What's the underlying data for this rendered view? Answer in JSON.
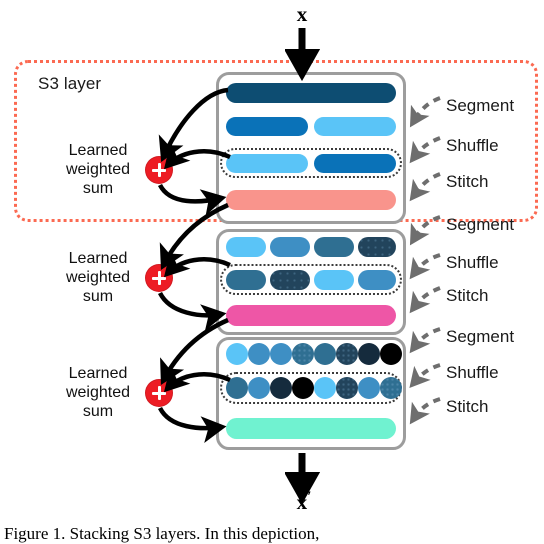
{
  "figure": {
    "input_label": "x",
    "output_label": "x",
    "output_prime": "′",
    "region_label": "S3 layer",
    "caption": "Figure 1.  Stacking S3 layers.  In this depiction,"
  },
  "colors": {
    "region_border": "#fb6a52",
    "box_border": "#9d9d9d",
    "plus_fill": "#ed1c24",
    "stitch_outline": "#3b3b3b",
    "dashed_arrow": "#6e6e6e",
    "solid_arrow": "#000000",
    "navy": "#0d4d72",
    "blue": "#0a72b8",
    "light_blue": "#5ac4f7",
    "salmon": "#f9948c",
    "pink": "#ee56a6",
    "mint": "#70f2d0",
    "mid_blue": "#3e8fc4",
    "steel": "#2f6f92",
    "dark_slate": "#22445c",
    "darkest": "#152b3d",
    "black": "#000000"
  },
  "ops": {
    "segment": "Segment",
    "shuffle": "Shuffle",
    "stitch": "Stitch"
  },
  "sum_label": {
    "line1": "Learned",
    "line2": "weighted",
    "line3": "sum"
  },
  "layers": [
    {
      "name": "layer-1",
      "segment_row": [
        {
          "color": "#0d4d72",
          "span": 2,
          "texture": "solid"
        }
      ],
      "shuffle_row": [
        {
          "color": "#0a72b8",
          "span": 1,
          "texture": "solid"
        },
        {
          "color": "#5ac4f7",
          "span": 1,
          "texture": "solid"
        }
      ],
      "stitch_row": [
        {
          "color": "#5ac4f7",
          "span": 1,
          "texture": "solid"
        },
        {
          "color": "#0a72b8",
          "span": 1,
          "texture": "solid"
        }
      ],
      "output_bar": {
        "color": "#f9948c"
      },
      "shape": "bar",
      "segments": 1
    },
    {
      "name": "layer-2",
      "segment_row": [
        {
          "color": "#5ac4f7",
          "texture": "solid"
        },
        {
          "color": "#3e8fc4",
          "texture": "solid"
        },
        {
          "color": "#2f6f92",
          "texture": "solid"
        },
        {
          "color": "#22445c",
          "texture": "dots"
        }
      ],
      "shuffle_row": [],
      "stitch_row": [
        {
          "color": "#2f6f92",
          "texture": "solid"
        },
        {
          "color": "#22445c",
          "texture": "dots"
        },
        {
          "color": "#5ac4f7",
          "texture": "solid"
        },
        {
          "color": "#3e8fc4",
          "texture": "solid"
        }
      ],
      "output_bar": {
        "color": "#ee56a6"
      },
      "shape": "bar",
      "segments": 4
    },
    {
      "name": "layer-3",
      "segment_row": [
        {
          "color": "#5ac4f7",
          "texture": "solid"
        },
        {
          "color": "#3e8fc4",
          "texture": "solid"
        },
        {
          "color": "#3e8fc4",
          "texture": "solid"
        },
        {
          "color": "#2f6f92",
          "texture": "dots"
        },
        {
          "color": "#2f6f92",
          "texture": "solid"
        },
        {
          "color": "#22445c",
          "texture": "dots"
        },
        {
          "color": "#152b3d",
          "texture": "solid"
        },
        {
          "color": "#000000",
          "texture": "solid"
        }
      ],
      "shuffle_row": [],
      "stitch_row": [
        {
          "color": "#2f6f92",
          "texture": "solid"
        },
        {
          "color": "#3e8fc4",
          "texture": "solid"
        },
        {
          "color": "#152b3d",
          "texture": "solid"
        },
        {
          "color": "#000000",
          "texture": "solid"
        },
        {
          "color": "#5ac4f7",
          "texture": "solid"
        },
        {
          "color": "#22445c",
          "texture": "dots"
        },
        {
          "color": "#3e8fc4",
          "texture": "solid"
        },
        {
          "color": "#2f6f92",
          "texture": "dots"
        }
      ],
      "output_bar": {
        "color": "#70f2d0"
      },
      "shape": "circle",
      "segments": 8
    }
  ]
}
